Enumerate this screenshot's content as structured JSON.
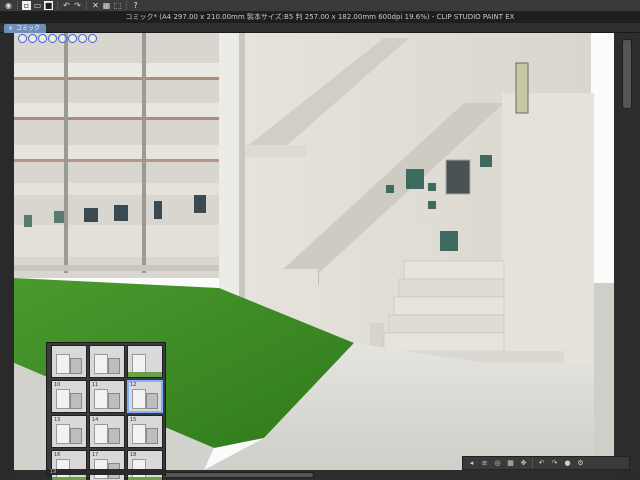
{
  "toolbar": {
    "icons": [
      "app-icon",
      "new-icon",
      "open-icon",
      "save-icon",
      "undo-icon",
      "redo-icon",
      "clear-icon",
      "fill-icon",
      "transform-icon",
      "help-icon"
    ]
  },
  "window": {
    "title": "コミック* (A4 297.00 x 210.00mm 製本サイズ:B5 判 257.00 x 182.00mm 600dpi 19.6%) - CLIP STUDIO PAINT EX"
  },
  "tab": {
    "close_glyph": "×",
    "label": "コミック"
  },
  "panel": {
    "thumbnails": [
      {
        "num": ""
      },
      {
        "num": ""
      },
      {
        "num": ""
      },
      {
        "num": "10"
      },
      {
        "num": "11"
      },
      {
        "num": "12"
      },
      {
        "num": "13"
      },
      {
        "num": "14"
      },
      {
        "num": "15"
      },
      {
        "num": "16"
      },
      {
        "num": "17"
      },
      {
        "num": "18"
      }
    ],
    "footer": "19"
  },
  "colors": {
    "accent": "#6f8fb8",
    "grass": "#3d8a26",
    "concrete": "#dcdcd6",
    "rust": "#8a4a3a"
  }
}
